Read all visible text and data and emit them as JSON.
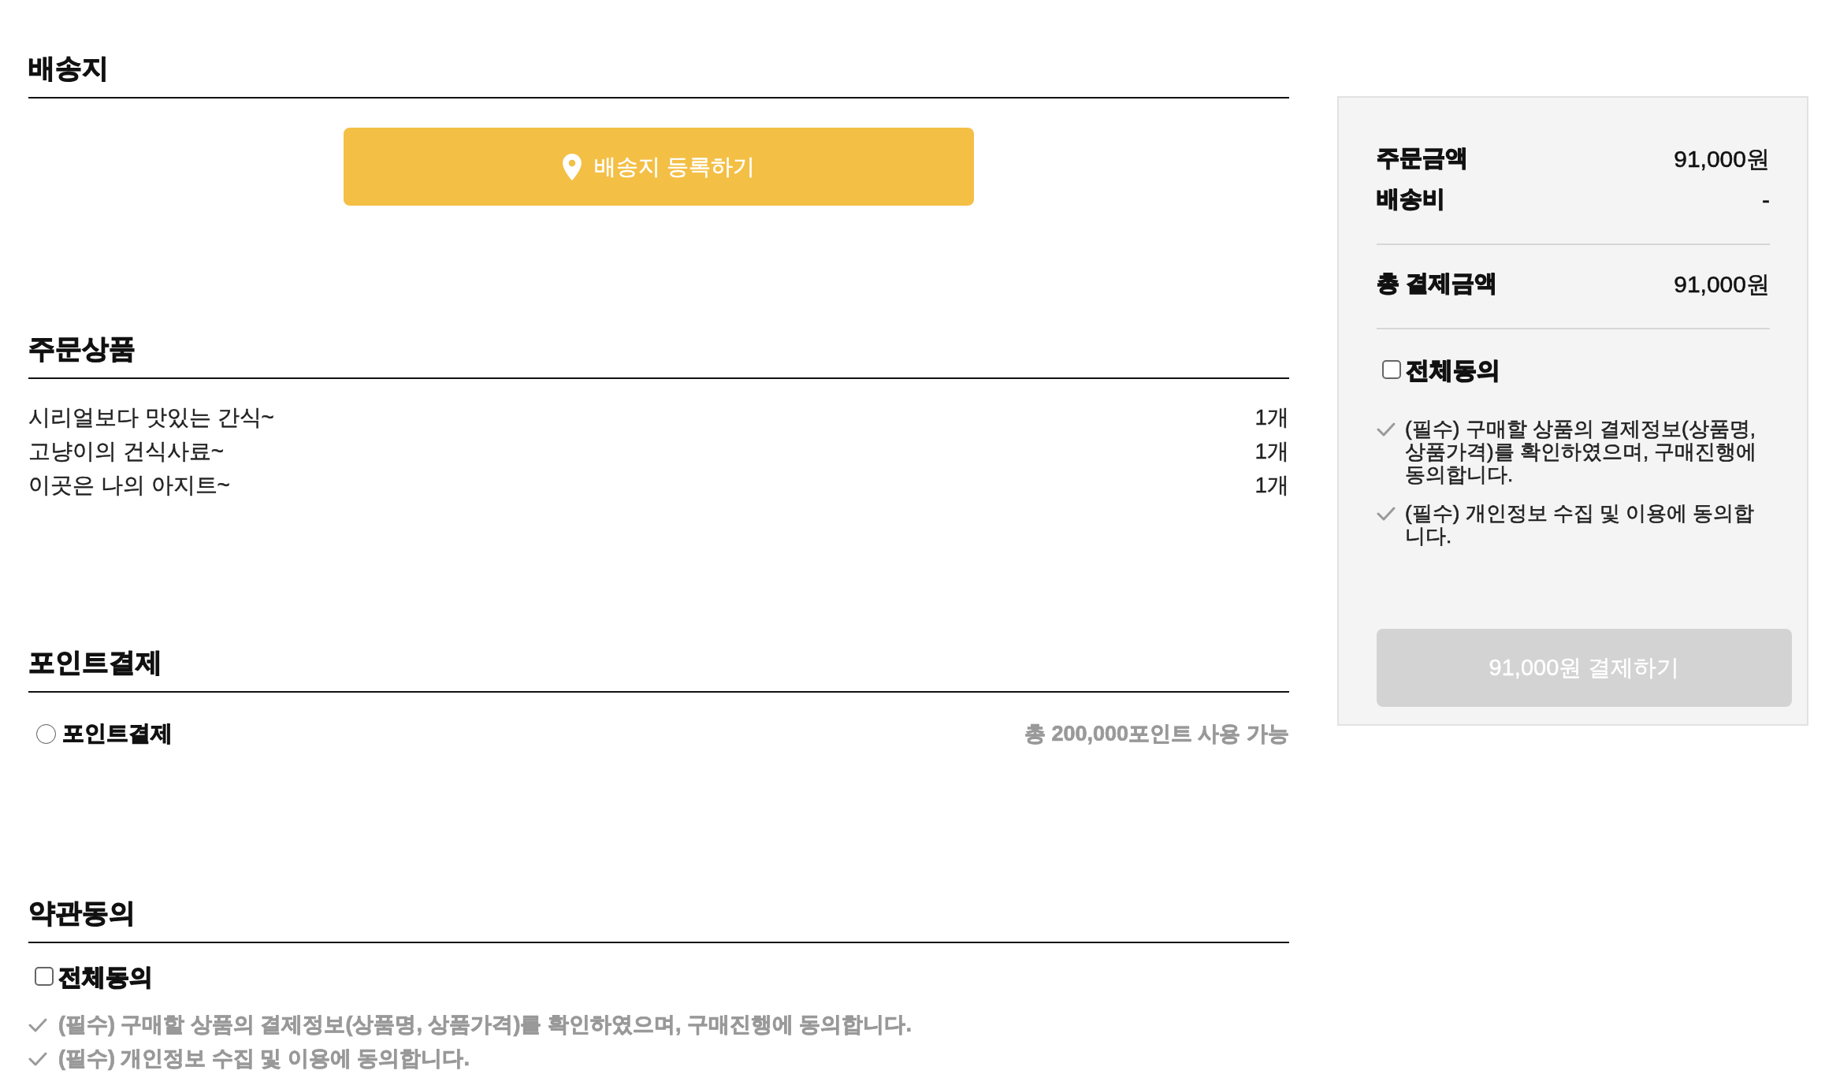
{
  "shipping": {
    "title": "배송지",
    "register_button": "배송지 등록하기"
  },
  "order_items": {
    "title": "주문상품",
    "items": [
      {
        "name": "시리얼보다 맛있는 간식~",
        "quantity": "1개"
      },
      {
        "name": "고냥이의 건식사료~",
        "quantity": "1개"
      },
      {
        "name": "이곳은 나의 아지트~",
        "quantity": "1개"
      }
    ]
  },
  "point_payment": {
    "title": "포인트결제",
    "option": {
      "label": "포인트결제",
      "selected": false
    },
    "available": "총 200,000포인트 사용 가능"
  },
  "terms": {
    "title": "약관동의",
    "agree_all": {
      "label": "전체동의",
      "checked": false
    },
    "items": [
      "(필수) 구매할 상품의 결제정보(상품명, 상품가격)를 확인하였으며, 구매진행에 동의합니다.",
      "(필수) 개인정보 수집 및 이용에 동의합니다."
    ]
  },
  "summary": {
    "rows": [
      {
        "label": "주문금액",
        "value": "91,000원"
      },
      {
        "label": "배송비",
        "value": "-"
      }
    ],
    "total": {
      "label": "총 결제금액",
      "value": "91,000원"
    },
    "agree_all": {
      "label": "전체동의",
      "checked": false
    },
    "terms": [
      "(필수) 구매할 상품의 결제정보(상품명, 상품가격)를 확인하였으며, 구매진행에 동의합니다.",
      "(필수) 개인정보 수집 및 이용에 동의합니다."
    ],
    "pay_button": {
      "label": "91,000원 결제하기",
      "disabled": true
    }
  }
}
